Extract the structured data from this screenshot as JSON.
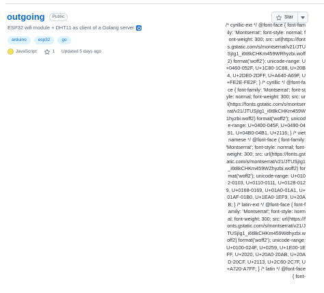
{
  "repo": {
    "name": "outgoing",
    "visibility": "Public",
    "description": "ESP32 wifi module + DHT11 as client of a Golang server",
    "topics": [
      "arduino",
      "esp32",
      "go"
    ],
    "language": "JavaScript",
    "language_color": "#f1e05a",
    "stars": "1",
    "updated": "Updated 5 days ago"
  },
  "star_button": {
    "label": "Star",
    "icon": "star-icon",
    "dropdown_icon": "triangle-down-icon"
  },
  "leaked_css": "/* cyrillic-ext */ @font-face { font-family: 'Montserrat'; font-style: normal; font-weight: 300; src: url(https://fonts.gstatic.com/s/montserrat/v21/JTUSjIg1_i6t8kCHKm459WRhyzbi.woff2) format('woff2'); unicode-range: U+0460-052F, U+1C80-1C88, U+20B4, U+2DE0-2DFF, U+A640-A69F, U+FE2E-FE2F; } /* cyrillic */ @font-face { font-family: 'Montserrat'; font-style: normal; font-weight: 300; src: url(https://fonts.gstatic.com/s/montserrat/v21/JTUSjIg1_i6t8kCHKm459W1hyzbi.woff2) format('woff2'); unicode-range: U+0400-045F, U+0490-0491, U+04B0-04B1, U+2116; } /* vietnamese */ @font-face { font-family: 'Montserrat'; font-style: normal; font-weight: 300; src: url(https://fonts.gstatic.com/s/montserrat/v21/JTUSjIg1_i6t8kCHKm459WZhyzbi.woff2) format('woff2'); unicode-range: U+0102-0103, U+0110-0111, U+0128-0129, U+0168-0169, U+01A0-01A1, U+01AF-01B0, U+1EA0-1EF9, U+20AB; } /* latin-ext */ @font-face { font-family: 'Montserrat'; font-style: normal; font-weight: 300; src: url(https://fonts.gstatic.com/s/montserrat/v21/JTUSjIg1_i6t8kCHKm459Wdhyzbi.woff2) format('woff2'); unicode-range: U+0100-024F, U+0259, U+1E00-1EFF, U+2020, U+20A0-20AB, U+20AD-20CF, U+2113, U+2C60-2C7F, U+A720-A7FF; } /* latin */ @font-face { font-"
}
